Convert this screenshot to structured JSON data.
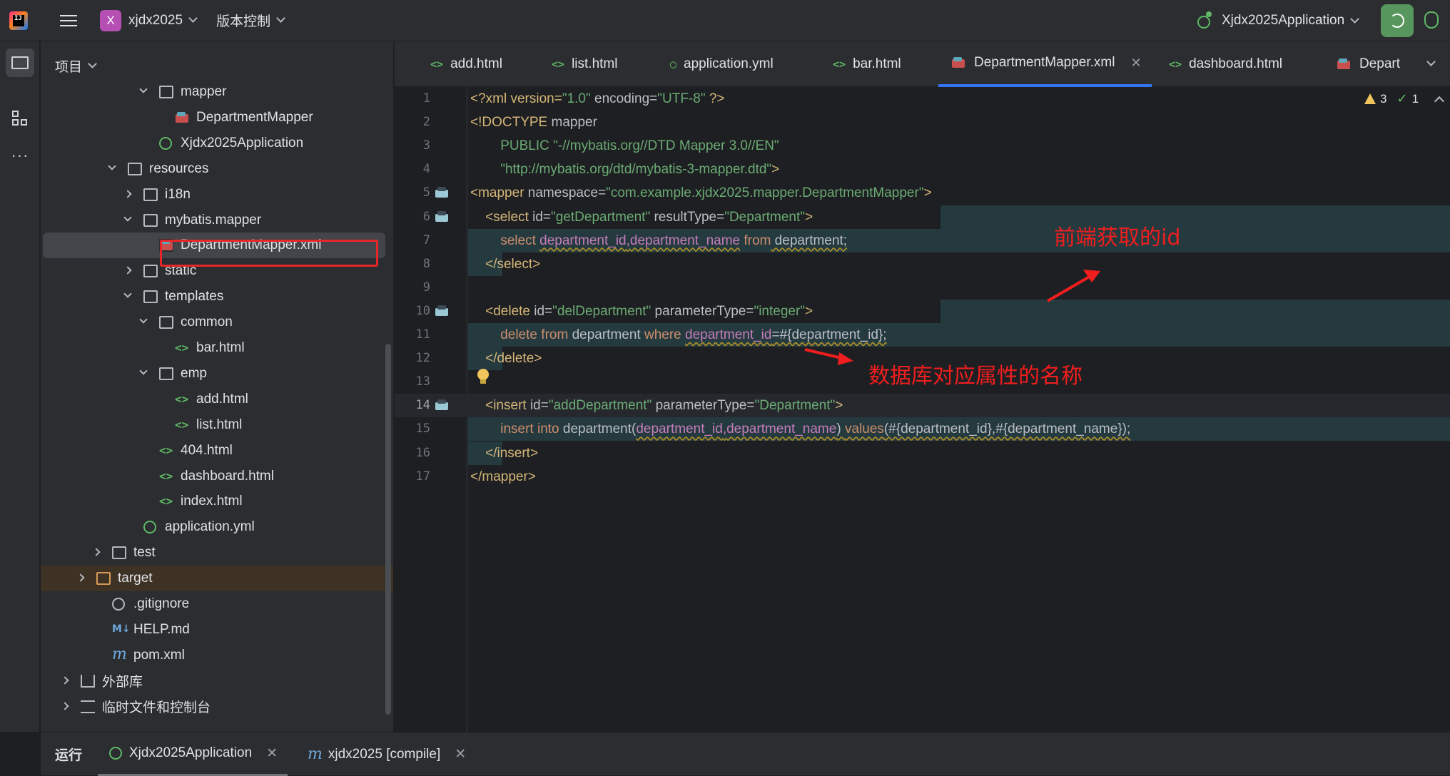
{
  "topbar": {
    "project_badge": "X",
    "project_name": "xjdx2025",
    "vcs_label": "版本控制",
    "run_config": "Xjdx2025Application"
  },
  "panel": {
    "title": "项目",
    "tree": [
      {
        "label": "mapper",
        "icon": "package-folder-icon",
        "expanded": true
      },
      {
        "label": "DepartmentMapper",
        "icon": "mybatis-mapper-icon"
      },
      {
        "label": "Xjdx2025Application",
        "icon": "spring-boot-app-icon"
      },
      {
        "label": "resources",
        "icon": "resources-folder-icon",
        "expanded": true
      },
      {
        "label": "i18n",
        "icon": "folder-icon",
        "expanded": false
      },
      {
        "label": "mybatis.mapper",
        "icon": "folder-icon",
        "expanded": true
      },
      {
        "label": "DepartmentMapper.xml",
        "icon": "mybatis-mapper-icon",
        "selected": true
      },
      {
        "label": "static",
        "icon": "folder-icon",
        "expanded": false
      },
      {
        "label": "templates",
        "icon": "folder-icon",
        "expanded": true
      },
      {
        "label": "common",
        "icon": "folder-icon",
        "expanded": true
      },
      {
        "label": "bar.html",
        "icon": "html-file-icon"
      },
      {
        "label": "emp",
        "icon": "folder-icon",
        "expanded": true
      },
      {
        "label": "add.html",
        "icon": "html-file-icon"
      },
      {
        "label": "list.html",
        "icon": "html-file-icon"
      },
      {
        "label": "404.html",
        "icon": "html-file-icon"
      },
      {
        "label": "dashboard.html",
        "icon": "html-file-icon"
      },
      {
        "label": "index.html",
        "icon": "html-file-icon"
      },
      {
        "label": "application.yml",
        "icon": "spring-yml-icon"
      },
      {
        "label": "test",
        "icon": "folder-icon",
        "expanded": false
      },
      {
        "label": "target",
        "icon": "excluded-folder-icon",
        "expanded": false
      },
      {
        "label": ".gitignore",
        "icon": "gitignore-icon"
      },
      {
        "label": "HELP.md",
        "icon": "markdown-icon"
      },
      {
        "label": "pom.xml",
        "icon": "maven-icon"
      },
      {
        "label": "外部库",
        "icon": "library-icon",
        "expanded": false
      },
      {
        "label": "临时文件和控制台",
        "icon": "scratches-icon",
        "expanded": false
      }
    ]
  },
  "editor_tabs": [
    {
      "label": "add.html",
      "icon": "html-file-icon"
    },
    {
      "label": "list.html",
      "icon": "html-file-icon"
    },
    {
      "label": "application.yml",
      "icon": "spring-yml-icon"
    },
    {
      "label": "bar.html",
      "icon": "html-file-icon"
    },
    {
      "label": "DepartmentMapper.xml",
      "icon": "mybatis-mapper-icon",
      "active": true
    },
    {
      "label": "dashboard.html",
      "icon": "html-file-icon"
    },
    {
      "label": "Depart",
      "icon": "mybatis-mapper-icon"
    }
  ],
  "inspections": {
    "warnings": "3",
    "ok": "1"
  },
  "code_lines": [
    {
      "n": "1"
    },
    {
      "n": "2"
    },
    {
      "n": "3"
    },
    {
      "n": "4"
    },
    {
      "n": "5"
    },
    {
      "n": "6"
    },
    {
      "n": "7"
    },
    {
      "n": "8"
    },
    {
      "n": "9"
    },
    {
      "n": "10"
    },
    {
      "n": "11"
    },
    {
      "n": "12"
    },
    {
      "n": "13"
    },
    {
      "n": "14"
    },
    {
      "n": "15"
    },
    {
      "n": "16"
    },
    {
      "n": "17"
    }
  ],
  "code": {
    "l1": [
      "<?xml version=",
      "\"1.0\"",
      " encoding=",
      "\"UTF-8\"",
      " ?>"
    ],
    "l2": [
      "<!DOCTYPE ",
      "mapper"
    ],
    "l3": [
      "        PUBLIC ",
      "\"-//mybatis.org//DTD Mapper 3.0//EN\""
    ],
    "l4": [
      "        ",
      "\"http://mybatis.org/dtd/mybatis-3-mapper.dtd\"",
      ">"
    ],
    "l5": [
      "<mapper ",
      "namespace=",
      "\"com.example.xjdx2025.mapper.DepartmentMapper\"",
      ">"
    ],
    "l6": [
      "    <select ",
      "id=",
      "\"getDepartment\"",
      " resultType=",
      "\"Department\"",
      ">"
    ],
    "l7": [
      "        ",
      "select",
      " ",
      "department_id",
      ",",
      "department_name",
      " ",
      "from",
      " department;"
    ],
    "l8": [
      "    </select>"
    ],
    "l10": [
      "    <delete ",
      "id=",
      "\"delDepartment\"",
      " parameterType=",
      "\"integer\"",
      ">"
    ],
    "l11": [
      "        ",
      "delete",
      " ",
      "from",
      " department ",
      "where",
      " ",
      "department_id",
      "=#{department_id};"
    ],
    "l12": [
      "    </delete>"
    ],
    "l14": [
      "    <insert ",
      "id=",
      "\"addDepartment\"",
      " parameterType=",
      "\"Department\"",
      ">"
    ],
    "l15": [
      "        ",
      "insert",
      " ",
      "into",
      " department(",
      "department_id",
      ",",
      "department_name",
      ") ",
      "values",
      "(#{department_id},#{department_name});"
    ],
    "l16": [
      "    </insert>"
    ],
    "l17": [
      "</mapper>"
    ]
  },
  "annotations": {
    "a1": "前端获取的id",
    "a2": "数据库对应属性的名称"
  },
  "bottom": {
    "run_label": "运行",
    "tab1": "Xjdx2025Application",
    "tab2": "xjdx2025 [compile]"
  },
  "colors": {
    "accent": "#3574f0",
    "annotation": "#f01e1e",
    "run_green": "#57965c"
  }
}
